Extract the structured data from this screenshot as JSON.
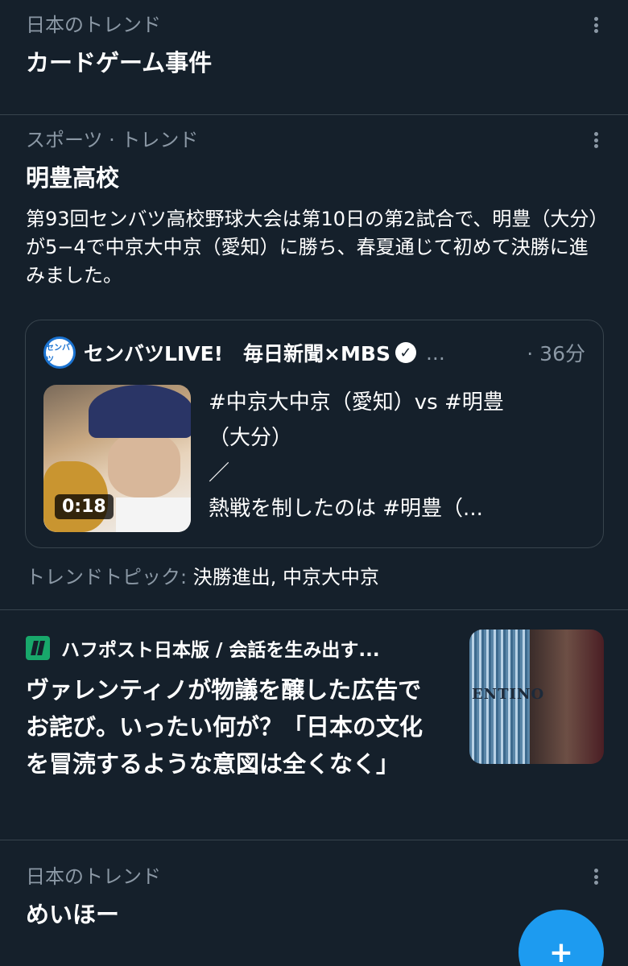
{
  "trends": [
    {
      "context": "日本のトレンド",
      "title": "カードゲーム事件"
    },
    {
      "context": "スポーツ · トレンド",
      "title": "明豊高校",
      "description": "第93回センバツ高校野球大会は第10日の第2試合で、明豊（大分）が5−4で中京大中京（愛知）に勝ち、春夏通じて初めて決勝に進みました。",
      "tweet": {
        "avatar_text": "センバツ",
        "author": "センバツLIVE!　毎日新聞×MBS",
        "ellipsis": "...",
        "time": "· 36分",
        "text": "#中京大中京（愛知）vs #明豊\n（大分）\n／\n熱戦を制したのは #明豊（...",
        "video_duration": "0:18"
      },
      "topics_label": "トレンドトピック: ",
      "topics": "決勝進出, 中京大中京"
    },
    {
      "context": "日本のトレンド",
      "title": "めいほー"
    }
  ],
  "news": {
    "source": "ハフポスト日本版 / 会話を生み出す...",
    "headline": "ヴァレンティノが物議を醸した広告でお詫び。いったい何が？「日本の文化を冒涜するような意図は全くなく」",
    "thumb_brand": "ENTINO"
  },
  "compose_button": {
    "label": "+"
  },
  "icons": {
    "more": "more-vertical-icon",
    "verified": "verified-badge-icon",
    "compose": "compose-tweet-icon"
  },
  "colors": {
    "background": "#15202b",
    "accent": "#1d9bf0",
    "secondary_text": "#8b98a5",
    "divider": "#38444d"
  }
}
